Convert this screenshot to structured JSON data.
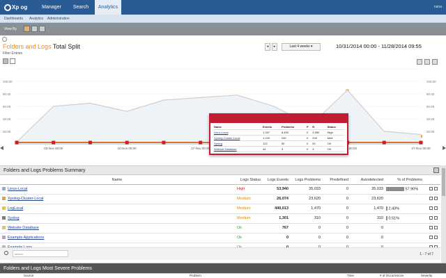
{
  "nav": {
    "logo": "Xp og",
    "tabs": [
      "Manager",
      "Search",
      "Analytics"
    ],
    "active_tab": "Analytics",
    "user": "nana"
  },
  "subnav": [
    "Dashboards",
    "Analytics",
    "Administration"
  ],
  "toolbar": {
    "label": "View By"
  },
  "chart_header": {
    "title_highlight": "Folders and Logs",
    "title_rest": " Total Split",
    "filter_label": "Filter Entries",
    "range": "Last 4 weeks",
    "date_range": "10/31/2014 00:00 - 11/28/2014 09:55"
  },
  "chart_data": {
    "type": "line",
    "x": [
      "",
      "03-Nov 00:00",
      "",
      "10-Nov 00:00",
      "",
      "17-Nov 00:00",
      "",
      "",
      "",
      "24-Nov 00:00",
      "",
      "27-Nov 00:00"
    ],
    "x_labels": [
      "03-Nov 00:00",
      "10-Nov 00:00",
      "17-Nov 00:00",
      "24-Nov 00:00",
      "27-Nov 00:00"
    ],
    "y_ticks_left": [
      "",
      "100.00",
      "80.00",
      "60.00",
      "40.00",
      "20.00"
    ],
    "y_ticks_right": [
      "",
      "100.00",
      "80.00",
      "60.00",
      "40.00",
      "20.00"
    ],
    "ylim": [
      0,
      120
    ],
    "series": [
      {
        "color": "#e8a23a",
        "values": [
          3,
          52,
          50,
          47,
          68,
          64,
          73,
          55,
          22,
          85,
          12,
          12
        ]
      },
      {
        "color": "#cfcfcf",
        "values": [
          3,
          60,
          65,
          52,
          70,
          74,
          78,
          60,
          30,
          86,
          20,
          15
        ]
      },
      {
        "color": "#f1b84a",
        "values": [
          3,
          3,
          3,
          3,
          3,
          3,
          3,
          3,
          3,
          3,
          3,
          3
        ]
      },
      {
        "color": "#c81e2e",
        "values": [
          2,
          2,
          2,
          2,
          2,
          2,
          2,
          2,
          2,
          2,
          2,
          2
        ]
      }
    ]
  },
  "popup": {
    "headers": [
      "Name",
      "Events",
      "Problems",
      "P",
      "R",
      "Status"
    ],
    "rows": [
      [
        "Linux-Local",
        "1,337",
        "8,450",
        "0",
        "3,950",
        "High"
      ],
      [
        "Xpolog-Cluster-Local",
        "1,100",
        "245",
        "0",
        "245",
        "Med"
      ],
      [
        "Syslog",
        "122",
        "50",
        "0",
        "50",
        "OK"
      ],
      [
        "Website Database",
        "44",
        "3",
        "0",
        "3",
        "OK"
      ]
    ]
  },
  "summary": {
    "title": "Folders and Logs Problems Summary",
    "headers": [
      "Name",
      "Logs Status",
      "Logs Events",
      "Logs Problems",
      "Predefined",
      "Autodetected",
      "% of Problems"
    ],
    "rows": [
      {
        "name": "Linux-Local",
        "color": "#8ab0d8",
        "status": "High",
        "events": "53,940",
        "problems": "35,033",
        "predefined": "0",
        "autodetected": "35,033",
        "pct": "57.90%",
        "pct_value": 57.9
      },
      {
        "name": "Xpolog-Cluster-Local",
        "color": "#e8a23a",
        "status": "Medium",
        "events": "26,074",
        "problems": "23,620",
        "predefined": "0",
        "autodetected": "23,620",
        "pct": "",
        "pct_value": 0
      },
      {
        "name": "LogLocal",
        "color": "#f1c232",
        "status": "Medium",
        "events": "440,013",
        "problems": "1,470",
        "predefined": "0",
        "autodetected": "1,470",
        "pct": "2.43%",
        "pct_value": 2.43
      },
      {
        "name": "Syslog",
        "color": "#7d7d7d",
        "status": "Medium",
        "events": "1,301",
        "problems": "310",
        "predefined": "0",
        "autodetected": "310",
        "pct": "0.51%",
        "pct_value": 0.51
      },
      {
        "name": "Website Database",
        "color": "#f0c060",
        "status": "Ok",
        "events": "767",
        "problems": "0",
        "predefined": "0",
        "autodetected": "0",
        "pct": "",
        "pct_value": 0
      },
      {
        "name": "Example Applications",
        "color": "#b4a0d8",
        "status": "Ok",
        "events": "0",
        "problems": "0",
        "predefined": "0",
        "autodetected": "0",
        "pct": "",
        "pct_value": 0
      },
      {
        "name": "Example Logs",
        "color": "#a0b8e0",
        "status": "Ok",
        "events": "0",
        "problems": "0",
        "predefined": "0",
        "autodetected": "0",
        "pct": "",
        "pct_value": 0
      }
    ],
    "search_placeholder": "search",
    "pager": "1 - 7 of 7"
  },
  "severe": {
    "title": "Folders and Logs Most Severe Problems",
    "columns": [
      "Source",
      "Problem",
      "Time",
      "# of Occurrences",
      "Severity"
    ]
  }
}
